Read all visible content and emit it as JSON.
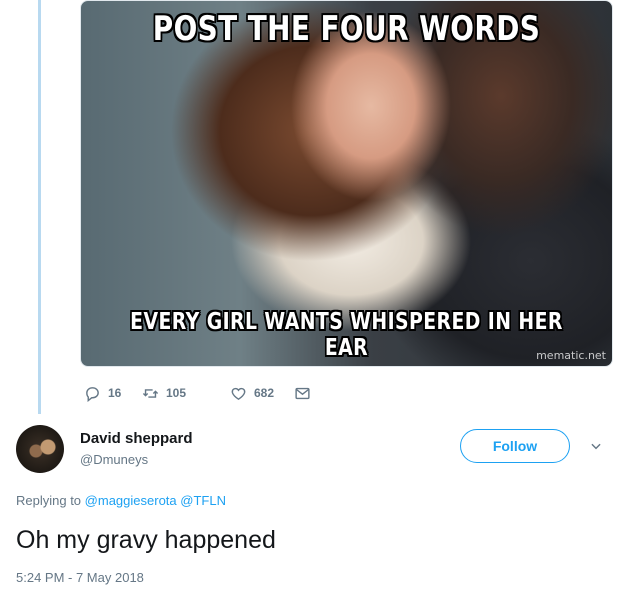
{
  "parent_tweet": {
    "meme": {
      "top_text": "POST THE FOUR WORDS",
      "bottom_text": "EVERY GIRL WANTS WHISPERED IN HER EAR",
      "watermark": "mematic.net"
    },
    "actions": {
      "replies": "16",
      "retweets": "105",
      "likes": "682",
      "reply_icon": "reply-icon",
      "retweet_icon": "retweet-icon",
      "like_icon": "heart-icon",
      "dm_icon": "envelope-icon"
    }
  },
  "reply_tweet": {
    "author": {
      "display_name": "David sheppard",
      "screen_name": "@Dmuneys"
    },
    "follow_label": "Follow",
    "replying_prefix": "Replying to",
    "replying_to": [
      "@maggieserota",
      "@TFLN"
    ],
    "text": "Oh my gravy happened",
    "timestamp": "5:24 PM - 7 May 2018"
  },
  "colors": {
    "accent": "#1da1f2",
    "secondary_text": "#657786",
    "thread_line": "#b8d9f0"
  }
}
